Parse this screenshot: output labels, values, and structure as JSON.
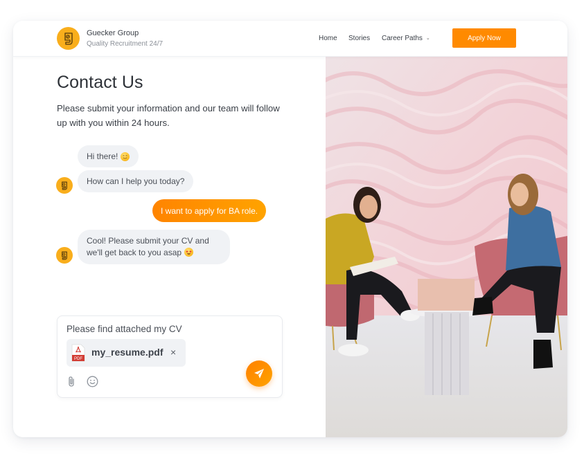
{
  "header": {
    "brand_name": "Guecker Group",
    "brand_tagline": "Quality Recruitment 24/7",
    "logo_letter": "g",
    "nav": [
      {
        "label": "Home"
      },
      {
        "label": "Stories"
      },
      {
        "label": "Career Paths",
        "has_dropdown": true
      }
    ],
    "nav_dropdown_glyph": "⌄",
    "cta_label": "Apply Now"
  },
  "main": {
    "title": "Contact Us",
    "subtitle": "Please submit your information and our team will follow up with you within 24 hours."
  },
  "chat": {
    "messages": [
      {
        "from": "bot",
        "text": "Hi there!",
        "emoji": "smiling-face"
      },
      {
        "from": "bot",
        "text": "How can I help you today?",
        "avatar": true
      },
      {
        "from": "user",
        "text": "I want to apply for BA role."
      },
      {
        "from": "bot",
        "text": "Cool! Please submit your CV and we'll get back to you asap",
        "emoji": "star-struck-face",
        "avatar": true
      }
    ]
  },
  "composer": {
    "text": "Please find attached my CV",
    "attachment": {
      "file_name": "my_resume.pdf",
      "file_type": "PDF",
      "remove_glyph": "×"
    },
    "icons": [
      "paperclip-icon",
      "emoji-icon",
      "send-icon"
    ]
  },
  "image": {
    "description": "Two women sitting on pink velvet chairs chatting beside a small white column table with a laptop, pink marbled wall behind"
  },
  "colors": {
    "accent": "#ff8a00",
    "logo": "#f9ae1c",
    "bubble_bg": "#f0f2f5",
    "text_dark": "#2e3238"
  }
}
